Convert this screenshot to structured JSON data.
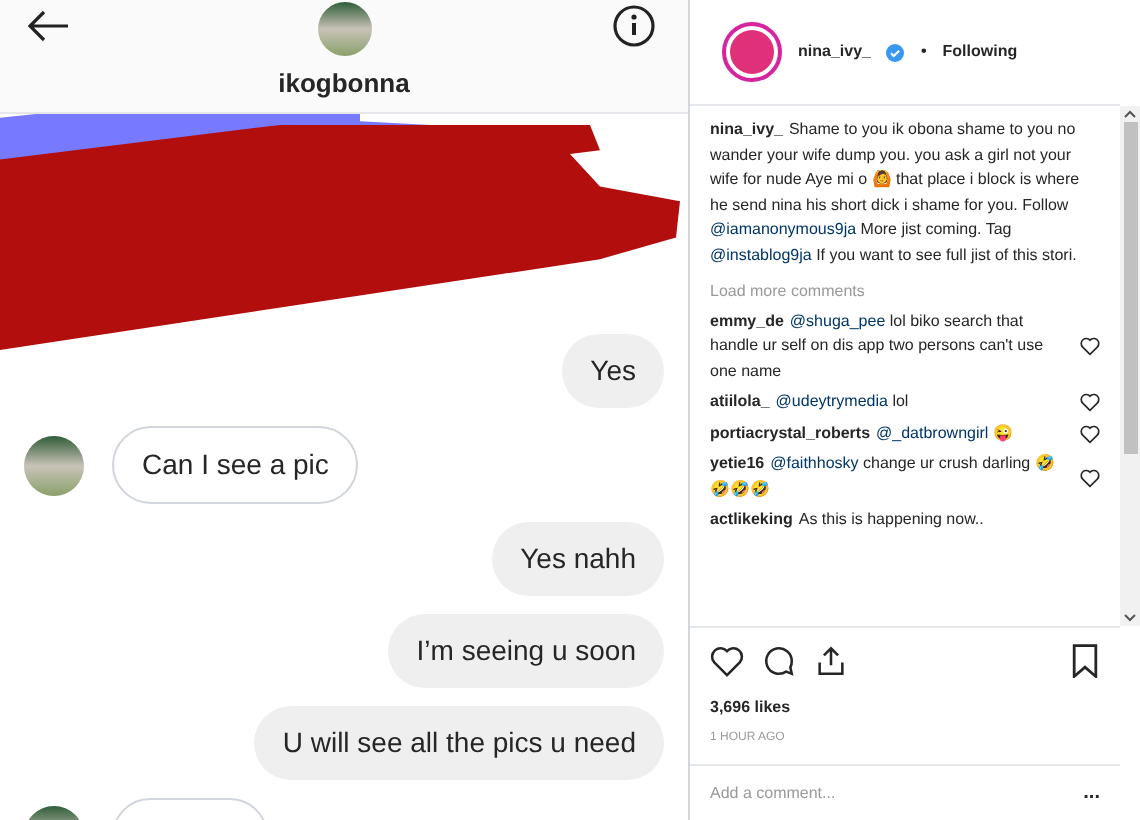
{
  "photo": {
    "chat_user": "ikogbonna",
    "messages": [
      {
        "kind": "sent",
        "text": "Yes"
      },
      {
        "kind": "received",
        "text": "Can I see a pic"
      },
      {
        "kind": "sent",
        "text": "Yes nahh"
      },
      {
        "kind": "sent",
        "text": "I’m seeing u soon"
      },
      {
        "kind": "sent",
        "text": "U will see all the pics u need"
      },
      {
        "kind": "received"
      }
    ]
  },
  "post": {
    "user": "nina_ivy_",
    "verified": true,
    "separator": "•",
    "follow": "Following",
    "caption": {
      "user": "nina_ivy_",
      "segments": [
        {
          "kind": "text",
          "text": "Shame to you ik obona shame to you no wander your wife dump you. you ask a girl not your wife for nude Aye mi o 🙆 that place i block is where he send nina his short dick i shame for you. Follow"
        },
        {
          "kind": "mention",
          "text": "@iamanonymous9ja"
        },
        {
          "kind": "text",
          "text": "More jist coming. Tag"
        },
        {
          "kind": "mention",
          "text": "@instablog9ja"
        },
        {
          "kind": "text",
          "text": "If you want to see full jist of this stori."
        }
      ]
    },
    "load_more": "Load more comments",
    "comments": [
      {
        "user": "emmy_de",
        "mention": "@shuga_pee",
        "text": "lol biko search that handle ur self on dis app two persons can't use one name",
        "heart": true
      },
      {
        "user": "atiilola_",
        "mention": "@udeytrymedia",
        "text": "lol",
        "heart": true
      },
      {
        "user": "portiacrystal_roberts",
        "mention": "@_datbrowngirl",
        "text": "😜",
        "heart": true
      },
      {
        "user": "yetie16",
        "mention": "@faithhosky",
        "text": "change ur crush darling 🤣🤣🤣🤣",
        "heart": true
      },
      {
        "user": "actlikeking",
        "text": "As this is happening now..",
        "heart": false
      }
    ],
    "likes": "3,696 likes",
    "time": "1 HOUR AGO",
    "comment_placeholder": "Add a comment...",
    "more": "..."
  }
}
